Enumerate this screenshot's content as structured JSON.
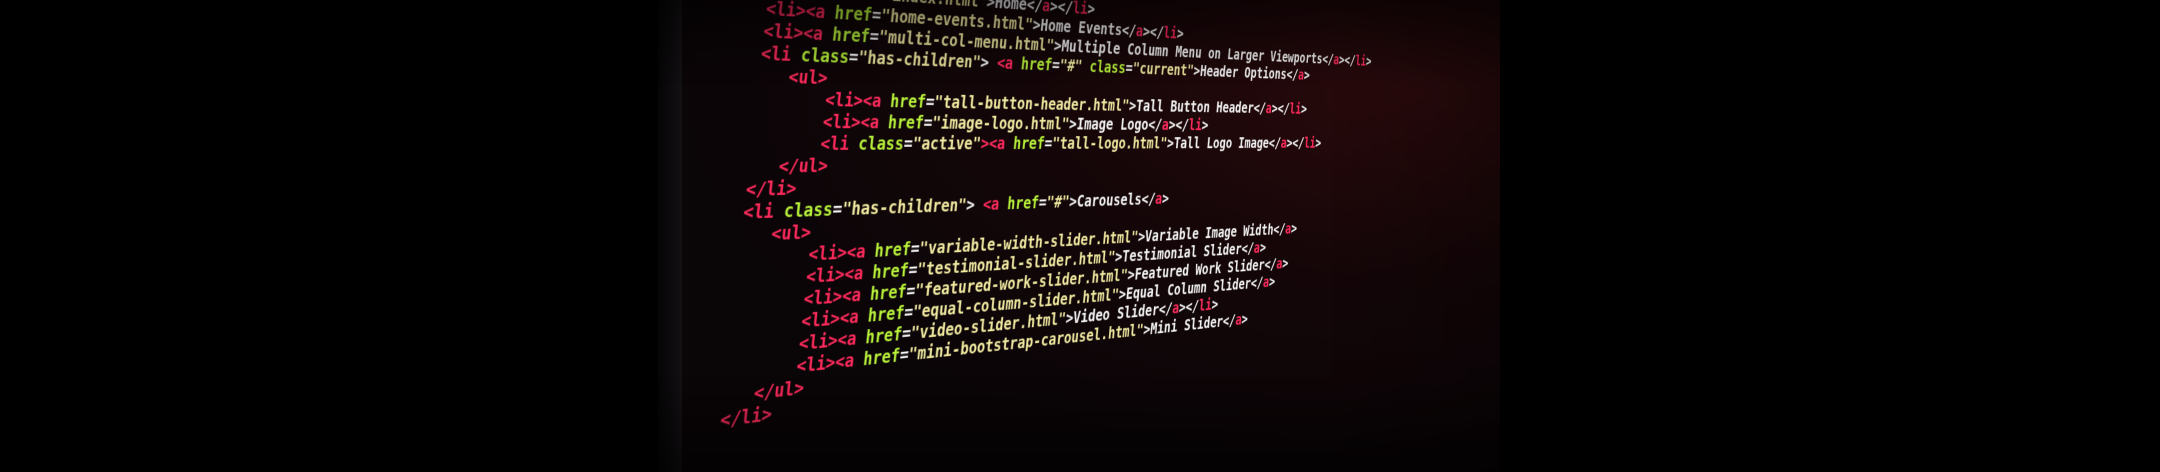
{
  "image": {
    "background_color": "#000000",
    "syntax_colors": {
      "tag": "#ff2a5c",
      "attribute": "#b8f23a",
      "string": "#f0e9a0",
      "text": "#f4f4f4"
    }
  },
  "code_lines": [
    {
      "indent": "     ",
      "parts": [
        {
          "cls": "tag",
          "text": "<li><a"
        },
        {
          "cls": "attr",
          "text": " href"
        },
        {
          "cls": "txt",
          "text": "="
        },
        {
          "cls": "str",
          "text": "\"index.html\""
        },
        {
          "cls": "txt",
          "text": ">Home</"
        },
        {
          "cls": "tag",
          "text": "a"
        },
        {
          "cls": "txt",
          "text": "></"
        },
        {
          "cls": "tag",
          "text": "li"
        },
        {
          "cls": "txt",
          "text": ">"
        }
      ]
    },
    {
      "indent": "     ",
      "parts": [
        {
          "cls": "tag",
          "text": "<li><a"
        },
        {
          "cls": "attr",
          "text": " href"
        },
        {
          "cls": "txt",
          "text": "="
        },
        {
          "cls": "str",
          "text": "\"home-events.html\""
        },
        {
          "cls": "txt",
          "text": ">Home Events</"
        },
        {
          "cls": "tag",
          "text": "a"
        },
        {
          "cls": "txt",
          "text": "></"
        },
        {
          "cls": "tag",
          "text": "li"
        },
        {
          "cls": "txt",
          "text": ">"
        }
      ]
    },
    {
      "indent": "     ",
      "parts": [
        {
          "cls": "tag",
          "text": "<li><a"
        },
        {
          "cls": "attr",
          "text": " href"
        },
        {
          "cls": "txt",
          "text": "="
        },
        {
          "cls": "str",
          "text": "\"multi-col-menu.html\""
        },
        {
          "cls": "txt",
          "text": ">Multiple Column Menu on Larger Viewports</"
        },
        {
          "cls": "tag",
          "text": "a"
        },
        {
          "cls": "txt",
          "text": "></"
        },
        {
          "cls": "tag",
          "text": "li"
        },
        {
          "cls": "txt",
          "text": ">"
        }
      ]
    },
    {
      "indent": "     ",
      "parts": [
        {
          "cls": "tag",
          "text": "<li"
        },
        {
          "cls": "attr",
          "text": " class"
        },
        {
          "cls": "txt",
          "text": "="
        },
        {
          "cls": "str",
          "text": "\"has-children\""
        },
        {
          "cls": "txt",
          "text": "> "
        },
        {
          "cls": "tag",
          "text": "<a"
        },
        {
          "cls": "attr",
          "text": " href"
        },
        {
          "cls": "txt",
          "text": "="
        },
        {
          "cls": "str",
          "text": "\"#\""
        },
        {
          "cls": "attr",
          "text": " class"
        },
        {
          "cls": "txt",
          "text": "="
        },
        {
          "cls": "str",
          "text": "\"current\""
        },
        {
          "cls": "txt",
          "text": ">Header Options</"
        },
        {
          "cls": "tag",
          "text": "a"
        },
        {
          "cls": "txt",
          "text": ">"
        }
      ]
    },
    {
      "indent": "        ",
      "parts": [
        {
          "cls": "tag",
          "text": "<ul>"
        }
      ]
    },
    {
      "indent": "            ",
      "parts": [
        {
          "cls": "tag",
          "text": "<li><a"
        },
        {
          "cls": "attr",
          "text": " href"
        },
        {
          "cls": "txt",
          "text": "="
        },
        {
          "cls": "str",
          "text": "\"tall-button-header.html\""
        },
        {
          "cls": "txt",
          "text": ">Tall Button Header</"
        },
        {
          "cls": "tag",
          "text": "a"
        },
        {
          "cls": "txt",
          "text": "></"
        },
        {
          "cls": "tag",
          "text": "li"
        },
        {
          "cls": "txt",
          "text": ">"
        }
      ]
    },
    {
      "indent": "            ",
      "parts": [
        {
          "cls": "tag",
          "text": "<li><a"
        },
        {
          "cls": "attr",
          "text": " href"
        },
        {
          "cls": "txt",
          "text": "="
        },
        {
          "cls": "str",
          "text": "\"image-logo.html\""
        },
        {
          "cls": "txt",
          "text": ">Image Logo</"
        },
        {
          "cls": "tag",
          "text": "a"
        },
        {
          "cls": "txt",
          "text": "></"
        },
        {
          "cls": "tag",
          "text": "li"
        },
        {
          "cls": "txt",
          "text": ">"
        }
      ]
    },
    {
      "indent": "            ",
      "parts": [
        {
          "cls": "tag",
          "text": "<li"
        },
        {
          "cls": "attr",
          "text": " class"
        },
        {
          "cls": "txt",
          "text": "="
        },
        {
          "cls": "str",
          "text": "\"active\""
        },
        {
          "cls": "tag",
          "text": "><a"
        },
        {
          "cls": "attr",
          "text": " href"
        },
        {
          "cls": "txt",
          "text": "="
        },
        {
          "cls": "str",
          "text": "\"tall-logo.html\""
        },
        {
          "cls": "txt",
          "text": ">Tall Logo Image</"
        },
        {
          "cls": "tag",
          "text": "a"
        },
        {
          "cls": "txt",
          "text": "></"
        },
        {
          "cls": "tag",
          "text": "li"
        },
        {
          "cls": "txt",
          "text": ">"
        }
      ]
    },
    {
      "indent": "        ",
      "parts": [
        {
          "cls": "tag",
          "text": "</ul>"
        }
      ]
    },
    {
      "indent": "     ",
      "parts": [
        {
          "cls": "tag",
          "text": "</li>"
        }
      ]
    },
    {
      "indent": "     ",
      "parts": [
        {
          "cls": "tag",
          "text": "<li"
        },
        {
          "cls": "attr",
          "text": " class"
        },
        {
          "cls": "txt",
          "text": "="
        },
        {
          "cls": "str",
          "text": "\"has-children\""
        },
        {
          "cls": "txt",
          "text": "> "
        },
        {
          "cls": "tag",
          "text": "<a"
        },
        {
          "cls": "attr",
          "text": " href"
        },
        {
          "cls": "txt",
          "text": "="
        },
        {
          "cls": "str",
          "text": "\"#\""
        },
        {
          "cls": "txt",
          "text": ">Carousels</"
        },
        {
          "cls": "tag",
          "text": "a"
        },
        {
          "cls": "txt",
          "text": ">"
        }
      ]
    },
    {
      "indent": "        ",
      "parts": [
        {
          "cls": "tag",
          "text": "<ul>"
        }
      ]
    },
    {
      "indent": "            ",
      "parts": [
        {
          "cls": "tag",
          "text": "<li><a"
        },
        {
          "cls": "attr",
          "text": " href"
        },
        {
          "cls": "txt",
          "text": "="
        },
        {
          "cls": "str",
          "text": "\"variable-width-slider.html\""
        },
        {
          "cls": "txt",
          "text": ">Variable Image Width</"
        },
        {
          "cls": "tag",
          "text": "a"
        },
        {
          "cls": "txt",
          "text": ">"
        }
      ]
    },
    {
      "indent": "            ",
      "parts": [
        {
          "cls": "tag",
          "text": "<li><a"
        },
        {
          "cls": "attr",
          "text": " href"
        },
        {
          "cls": "txt",
          "text": "="
        },
        {
          "cls": "str",
          "text": "\"testimonial-slider.html\""
        },
        {
          "cls": "txt",
          "text": ">Testimonial Slider</"
        },
        {
          "cls": "tag",
          "text": "a"
        },
        {
          "cls": "txt",
          "text": ">"
        }
      ]
    },
    {
      "indent": "            ",
      "parts": [
        {
          "cls": "tag",
          "text": "<li><a"
        },
        {
          "cls": "attr",
          "text": " href"
        },
        {
          "cls": "txt",
          "text": "="
        },
        {
          "cls": "str",
          "text": "\"featured-work-slider.html\""
        },
        {
          "cls": "txt",
          "text": ">Featured Work Slider</"
        },
        {
          "cls": "tag",
          "text": "a"
        },
        {
          "cls": "txt",
          "text": ">"
        }
      ]
    },
    {
      "indent": "            ",
      "parts": [
        {
          "cls": "tag",
          "text": "<li><a"
        },
        {
          "cls": "attr",
          "text": " href"
        },
        {
          "cls": "txt",
          "text": "="
        },
        {
          "cls": "str",
          "text": "\"equal-column-slider.html\""
        },
        {
          "cls": "txt",
          "text": ">Equal Column Slider</"
        },
        {
          "cls": "tag",
          "text": "a"
        },
        {
          "cls": "txt",
          "text": ">"
        }
      ]
    },
    {
      "indent": "            ",
      "parts": [
        {
          "cls": "tag",
          "text": "<li><a"
        },
        {
          "cls": "attr",
          "text": " href"
        },
        {
          "cls": "txt",
          "text": "="
        },
        {
          "cls": "str",
          "text": "\"video-slider.html\""
        },
        {
          "cls": "txt",
          "text": ">Video Slider</"
        },
        {
          "cls": "tag",
          "text": "a"
        },
        {
          "cls": "txt",
          "text": "></"
        },
        {
          "cls": "tag",
          "text": "li"
        },
        {
          "cls": "txt",
          "text": ">"
        }
      ]
    },
    {
      "indent": "            ",
      "parts": [
        {
          "cls": "tag",
          "text": "<li><a"
        },
        {
          "cls": "attr",
          "text": " href"
        },
        {
          "cls": "txt",
          "text": "="
        },
        {
          "cls": "str",
          "text": "\"mini-bootstrap-carousel.html\""
        },
        {
          "cls": "txt",
          "text": ">Mini Slider</"
        },
        {
          "cls": "tag",
          "text": "a"
        },
        {
          "cls": "txt",
          "text": ">"
        }
      ]
    },
    {
      "indent": "        ",
      "parts": [
        {
          "cls": "tag",
          "text": "</ul>"
        }
      ]
    },
    {
      "indent": "     ",
      "parts": [
        {
          "cls": "tag",
          "text": "</li>"
        }
      ]
    }
  ]
}
